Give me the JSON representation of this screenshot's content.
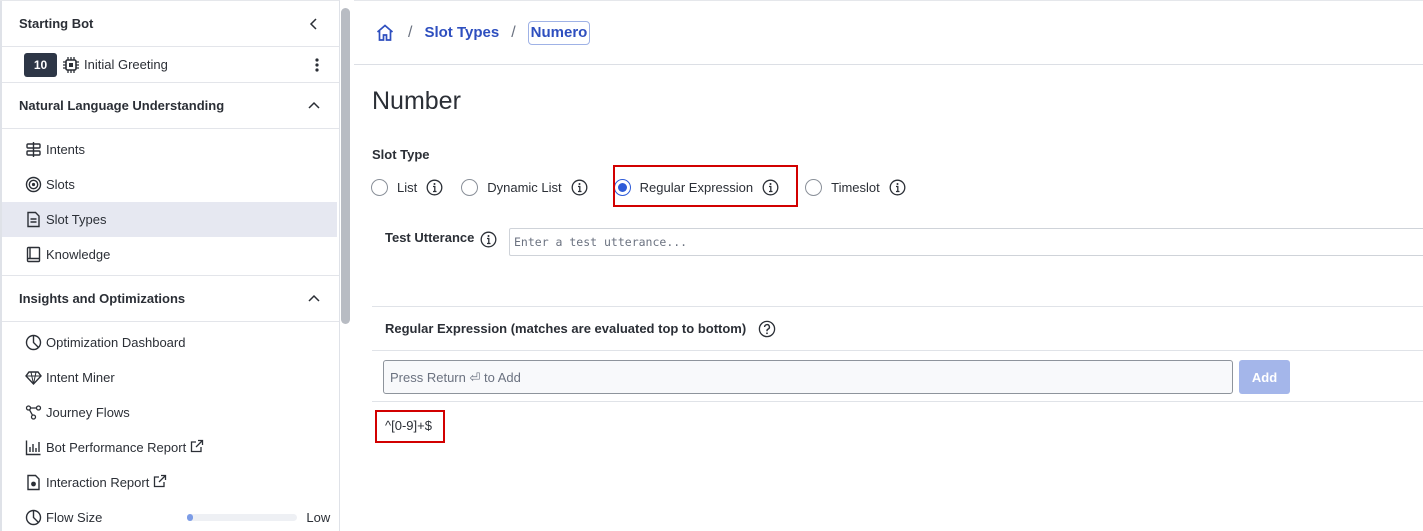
{
  "sidebar": {
    "header_title": "Starting Bot",
    "flow": {
      "badge": "10",
      "label": "Initial Greeting"
    },
    "sections": [
      {
        "title": "Natural Language Understanding",
        "items": [
          {
            "label": "Intents",
            "icon": "intents-icon"
          },
          {
            "label": "Slots",
            "icon": "slots-icon"
          },
          {
            "label": "Slot Types",
            "icon": "slot-types-icon",
            "active": true
          },
          {
            "label": "Knowledge",
            "icon": "knowledge-icon"
          }
        ]
      },
      {
        "title": "Insights and Optimizations",
        "items": [
          {
            "label": "Optimization Dashboard",
            "icon": "pie-chart-icon"
          },
          {
            "label": "Intent Miner",
            "icon": "diamond-icon"
          },
          {
            "label": "Journey Flows",
            "icon": "flow-icon"
          },
          {
            "label": "Bot Performance Report",
            "icon": "bar-chart-icon",
            "external": true
          },
          {
            "label": "Interaction Report",
            "icon": "report-icon",
            "external": true
          },
          {
            "label": "Flow Size",
            "icon": "pie-chart-icon",
            "meter_label": "Low",
            "meter_level": 0.05
          }
        ]
      }
    ]
  },
  "breadcrumb": {
    "items": [
      "Slot Types",
      "Numero"
    ],
    "separator": "/"
  },
  "page": {
    "title": "Number",
    "slot_type_label": "Slot Type",
    "slot_type_options": [
      "List",
      "Dynamic List",
      "Regular Expression",
      "Timeslot"
    ],
    "selected_slot_type": "Regular Expression",
    "test_utterance_label": "Test Utterance",
    "test_utterance_placeholder": "Enter a test utterance...",
    "regex_section_label": "Regular Expression (matches are evaluated top to bottom)",
    "regex_input_placeholder": "Press Return ⏎ to Add",
    "add_button_label": "Add",
    "regex_entries": [
      "^[0-9]+$"
    ]
  },
  "colors": {
    "accent": "#2e5bd8",
    "link": "#2e4fbf",
    "highlight_box": "#d20000",
    "add_button_disabled": "#a4b6ea"
  }
}
